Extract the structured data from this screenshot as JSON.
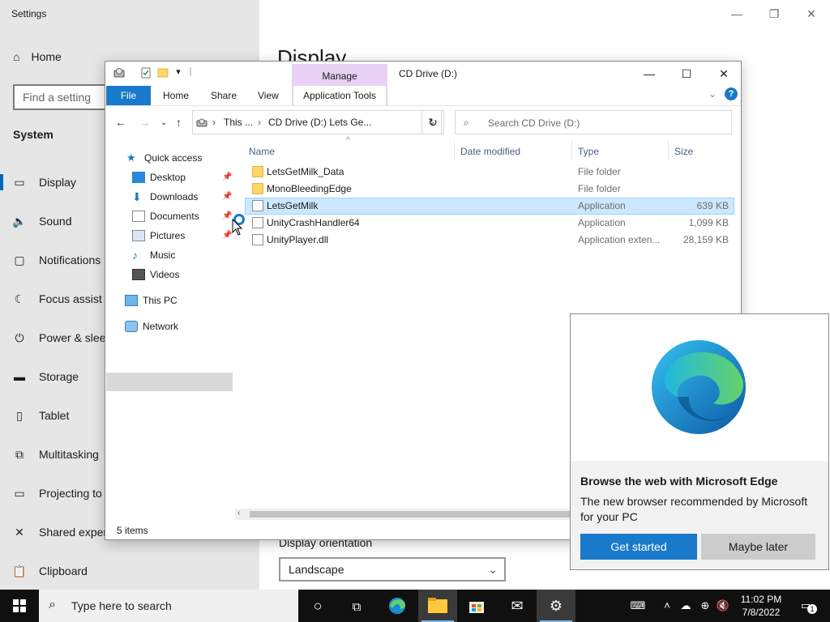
{
  "settings": {
    "title": "Settings",
    "controls": {
      "minimize": "—",
      "restore": "❐",
      "close": "✕"
    },
    "home_label": "Home",
    "search_placeholder": "Find a setting",
    "section": "System",
    "heading": "Display",
    "nav": [
      {
        "icon": "▭",
        "label": "Display"
      },
      {
        "icon": "🔈",
        "label": "Sound"
      },
      {
        "icon": "▢",
        "label": "Notifications"
      },
      {
        "icon": "☾",
        "label": "Focus assist"
      },
      {
        "icon": "⏻",
        "label": "Power & sleep"
      },
      {
        "icon": "▬",
        "label": "Storage"
      },
      {
        "icon": "▯",
        "label": "Tablet"
      },
      {
        "icon": "⧉",
        "label": "Multitasking"
      },
      {
        "icon": "▭",
        "label": "Projecting to this PC"
      },
      {
        "icon": "✕",
        "label": "Shared experiences"
      },
      {
        "icon": "📋",
        "label": "Clipboard"
      }
    ],
    "orientation_label": "Display orientation",
    "orientation_value": "Landscape"
  },
  "explorer": {
    "title": "CD Drive (D:)",
    "manage_tab": "Manage",
    "ribbon": {
      "file": "File",
      "home": "Home",
      "share": "Share",
      "view": "View",
      "tools": "Application Tools"
    },
    "address": {
      "part1": "This ...",
      "sep": "›",
      "part2": "CD Drive (D:) Lets Ge..."
    },
    "search_placeholder": "Search CD Drive (D:)",
    "navpane": {
      "quick_access": "Quick access",
      "desktop": "Desktop",
      "downloads": "Downloads",
      "documents": "Documents",
      "pictures": "Pictures",
      "music": "Music",
      "videos": "Videos",
      "this_pc": "This PC",
      "network": "Network"
    },
    "columns": {
      "name": "Name",
      "date": "Date modified",
      "type": "Type",
      "size": "Size"
    },
    "files": [
      {
        "name": "LetsGetMilk_Data",
        "type": "File folder",
        "size": "",
        "kind": "folder"
      },
      {
        "name": "MonoBleedingEdge",
        "type": "File folder",
        "size": "",
        "kind": "folder"
      },
      {
        "name": "LetsGetMilk",
        "type": "Application",
        "size": "639 KB",
        "kind": "file"
      },
      {
        "name": "UnityCrashHandler64",
        "type": "Application",
        "size": "1,099 KB",
        "kind": "file"
      },
      {
        "name": "UnityPlayer.dll",
        "type": "Application exten...",
        "size": "28,159 KB",
        "kind": "file"
      }
    ],
    "status": "5 items"
  },
  "edge_popup": {
    "title": "Browse the web with Microsoft Edge",
    "description": "The new browser recommended by Microsoft for your PC",
    "primary": "Get started",
    "secondary": "Maybe later"
  },
  "taskbar": {
    "search_text": "Type here to search",
    "time": "11:02 PM",
    "date": "7/8/2022",
    "notification_count": "1"
  },
  "colors": {
    "accent": "#1979ca",
    "manage": "#e9d1f5",
    "selection": "#cce8ff"
  }
}
